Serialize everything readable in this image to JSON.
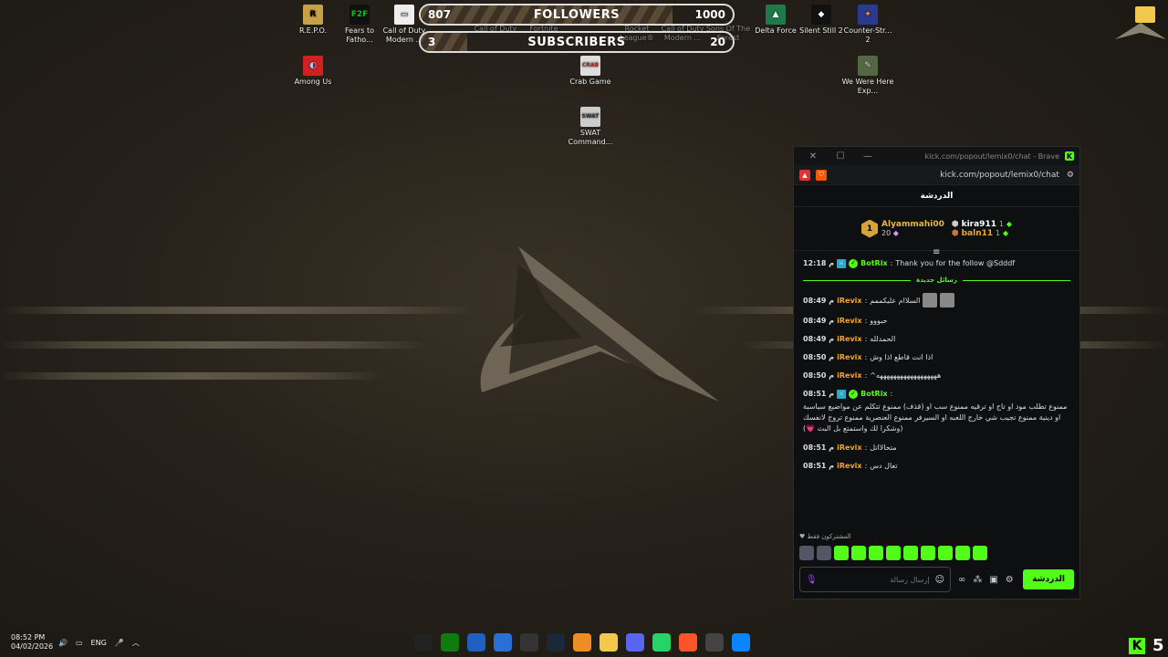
{
  "desktop_icons": [
    {
      "label": "R.E.P.O.",
      "icon": "repo-icon",
      "color": "#c9a04a"
    },
    {
      "label": "Fears to Fatho...",
      "icon": "fears-icon",
      "color": "#111111"
    },
    {
      "label": "Call of Duty Modern ...",
      "icon": "cod-icon",
      "color": "#eeeeee"
    },
    {
      "label": "Among Us",
      "icon": "among-us-icon",
      "color": "#d02020"
    },
    {
      "label": "Crab Game",
      "icon": "crab-game-icon",
      "color": "#dddddd"
    },
    {
      "label": "SWAT Command...",
      "icon": "swat-icon",
      "color": "#cccccc"
    },
    {
      "label": "Delta Force",
      "icon": "delta-force-icon",
      "color": "#1e7a4a"
    },
    {
      "label": "Silent Still 2",
      "icon": "silent-still-icon",
      "color": "#111111"
    },
    {
      "label": "Counter-Str... 2",
      "icon": "counter-strike-icon",
      "color": "#2a3b8f"
    },
    {
      "label": "We Were Here Exp...",
      "icon": "we-were-here-icon",
      "color": "#556644"
    }
  ],
  "hidden_icons": [
    "Call of Duty",
    "Fortnite",
    "Rocket League®",
    "Call of Duty Modern ...",
    "Sons Of The Forest"
  ],
  "overlay": {
    "followers": {
      "current": "807",
      "label": "FOLLOWERS",
      "goal": "1000",
      "progress": 0.807
    },
    "subscribers": {
      "current": "3",
      "label": "SUBSCRIBERS",
      "goal": "20",
      "progress": 0.15
    }
  },
  "window": {
    "title": "kick.com/popout/lemix0/chat - Brave",
    "url": "kick.com/popout/lemix0/chat"
  },
  "chat": {
    "header": "الدردشة",
    "leaderboard": {
      "first": {
        "rank": "1",
        "name": "Alyammahi00",
        "count": "20"
      },
      "second": {
        "name": "kira911",
        "count": "1"
      },
      "third": {
        "name": "baln11",
        "count": "1"
      }
    },
    "pinned": {
      "time": "12:18 م",
      "user": "BotRix",
      "text": "Thank you for the follow @Sdddf"
    },
    "new_messages_label": "رسائل جديدة",
    "messages": [
      {
        "time": "08:49 م",
        "user": "iRevix",
        "text": "السلاام عليكممم"
      },
      {
        "time": "08:49 م",
        "user": "iRevix",
        "text": "حبووو"
      },
      {
        "time": "08:49 م",
        "user": "iRevix",
        "text": "الحمدلله"
      },
      {
        "time": "08:50 م",
        "user": "iRevix",
        "text": "اذا انت قاطع اذا وش"
      },
      {
        "time": "08:50 م",
        "user": "iRevix",
        "text": "^ههههههههههههههههههه"
      },
      {
        "time": "08:51 م",
        "user": "BotRix",
        "text": "ممنوع تطلب مود او تاج او ترقيه ممنوع سب او (قذف) ممنوع تتكلم عن مواضيع سياسية او دينية ممنوع تجيب شي خارج اللعبه او السيرفر ممنوع العنصرية ممنوع تروج لانفسك (وشكرا لك واستمتع بل البث 💗)"
      },
      {
        "time": "08:51 م",
        "user": "iRevix",
        "text": "متحالااتل"
      },
      {
        "time": "08:51 م",
        "user": "iRevix",
        "text": "تعال دس"
      }
    ],
    "subscribers_only": "المشتركون فقط",
    "input_placeholder": "إرسال رسالة",
    "chat_button": "الدردشة"
  },
  "taskbar": {
    "time": "08:52 PM",
    "date": "04/02/2026",
    "lang": "ENG",
    "corner_number": "5"
  },
  "colors": {
    "kick_green": "#53fc18",
    "gold": "#e8b64a"
  }
}
